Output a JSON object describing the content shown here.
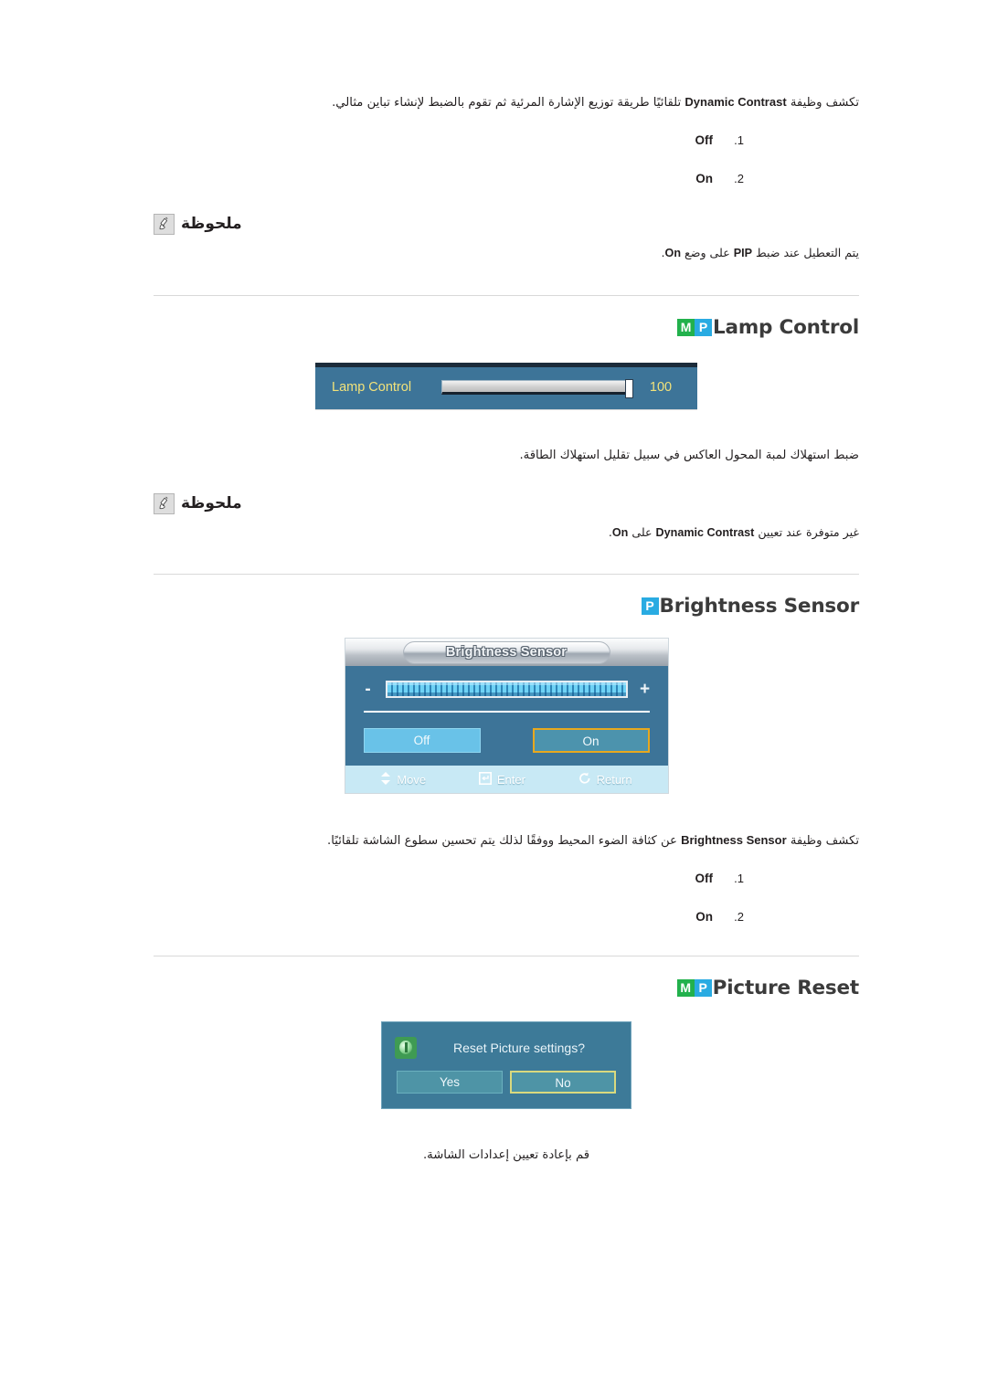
{
  "document": {
    "language": "ar",
    "colors": {
      "badge_m": "#22b14c",
      "badge_p": "#29abe2",
      "text": "#231f20",
      "rule": "#d9d9d9",
      "osd_background": "#3d7498",
      "osd_label_yellow": "#f2e27a",
      "osd_highlight_border": "#e8a81e",
      "osd_footer": "#c8e9f5"
    }
  },
  "dynamic_contrast": {
    "description": "تكشف وظيفة Dynamic Contrast تلقائيًا طريقة توزيع الإشارة المرئية ثم تقوم بالضبط لإنشاء تباين مثالي.",
    "description_pre": "تكشف وظيفة ",
    "description_term": "Dynamic Contrast",
    "description_post": " تلقائيًا طريقة توزيع الإشارة المرئية ثم تقوم بالضبط لإنشاء تباين مثالي.",
    "options": [
      {
        "num": ".1",
        "label": "Off"
      },
      {
        "num": ".2",
        "label": "On"
      }
    ],
    "note": {
      "title": "ملحوظة",
      "icon": "note-pen-icon",
      "body_pre": "يتم التعطيل عند ضبط ",
      "body_term": "PIP",
      "body_post": " على وضع ",
      "body_term2": "On",
      "body_end": "."
    }
  },
  "lamp_control": {
    "badges": [
      "M",
      "P"
    ],
    "title": "Lamp Control",
    "osd": {
      "label": "Lamp Control",
      "value": "100"
    },
    "description": "ضبط استهلاك لمبة المحول العاكس في سبيل تقليل استهلاك الطاقة.",
    "note": {
      "title": "ملحوظة",
      "icon": "note-pen-icon",
      "body_pre": "غير متوفرة عند تعيين ",
      "body_term": "Dynamic Contrast",
      "body_mid": " على ",
      "body_term2": "On",
      "body_end": "."
    }
  },
  "brightness_sensor": {
    "badges": [
      "P"
    ],
    "title": "Brightness Sensor",
    "osd": {
      "title": "Brightness Sensor",
      "minus": "-",
      "plus": "+",
      "buttons": [
        {
          "label": "Off",
          "selected": false
        },
        {
          "label": "On",
          "selected": true
        }
      ],
      "footer": [
        {
          "icon": "move-updown-icon",
          "glyph": "✦",
          "label": "Move"
        },
        {
          "icon": "enter-icon",
          "glyph": "⏎",
          "label": "Enter"
        },
        {
          "icon": "return-icon",
          "glyph": "↺",
          "label": "Return"
        }
      ]
    },
    "description_pre": "تكشف وظيفة ",
    "description_term": "Brightness Sensor",
    "description_post": " عن كثافة الضوء المحيط ووفقًا لذلك يتم تحسين سطوع الشاشة تلقائيًا.",
    "options": [
      {
        "num": ".1",
        "label": "Off"
      },
      {
        "num": ".2",
        "label": "On"
      }
    ]
  },
  "picture_reset": {
    "badges": [
      "M",
      "P"
    ],
    "title": "Picture Reset",
    "osd": {
      "icon": "info-icon",
      "message": "Reset Picture settings?",
      "buttons": [
        {
          "label": "Yes",
          "selected": false
        },
        {
          "label": "No",
          "selected": true
        }
      ]
    },
    "description": "قم بإعادة تعيين إعدادات الشاشة."
  }
}
